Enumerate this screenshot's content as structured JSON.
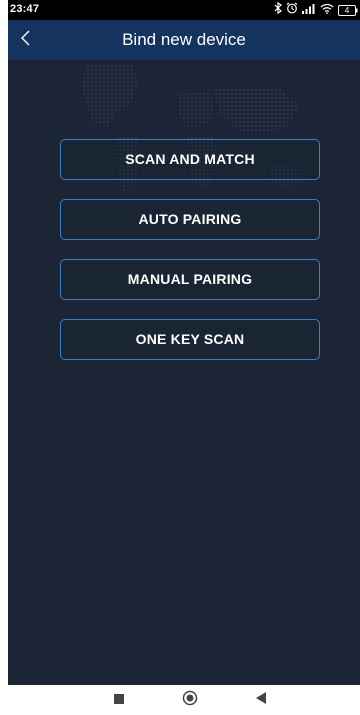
{
  "status_bar": {
    "time": "23:47",
    "icons": [
      "bluetooth-icon",
      "alarm-icon",
      "signal-icon",
      "wifi-icon",
      "battery-icon"
    ],
    "battery_level": "4"
  },
  "header": {
    "title": "Bind new device",
    "back_icon": "chevron-left-icon"
  },
  "buttons": [
    {
      "label": "SCAN AND MATCH"
    },
    {
      "label": "AUTO PAIRING"
    },
    {
      "label": "MANUAL PAIRING"
    },
    {
      "label": "ONE KEY SCAN"
    }
  ],
  "nav_bar": {
    "icons": [
      "recents-square-icon",
      "home-circle-icon",
      "back-triangle-icon"
    ]
  },
  "colors": {
    "background": "#1b2535",
    "header": "#14335f",
    "button_border": "#3d7dc4",
    "text": "#ffffff"
  }
}
